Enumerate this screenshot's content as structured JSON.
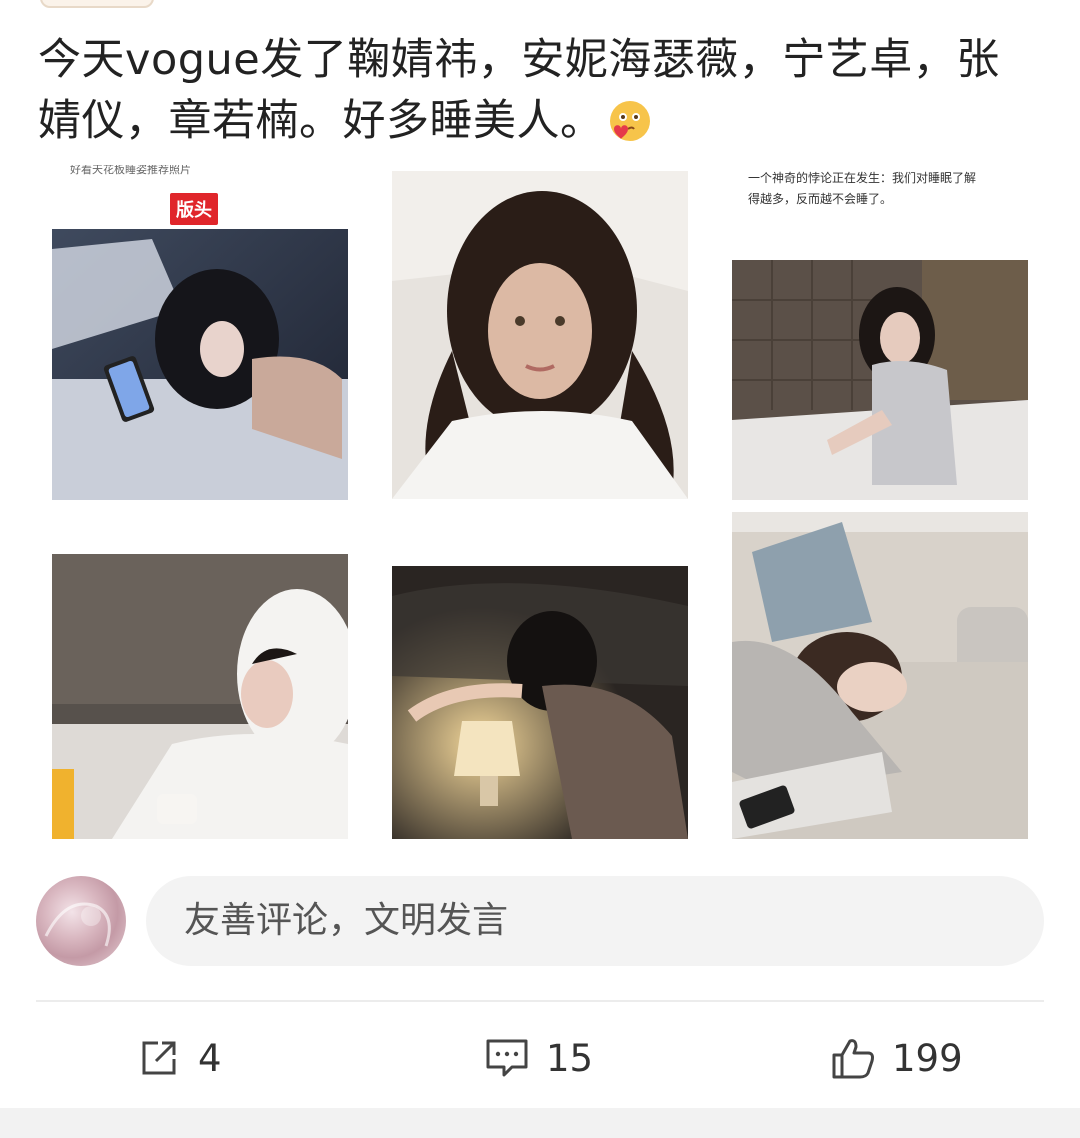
{
  "post": {
    "text": "今天vogue发了鞠婧祎，安妮海瑟薇，宁艺卓，张婧仪，章若楠。好多睡美人。",
    "emoji": "face-blowing-kiss-icon"
  },
  "images": {
    "cell1": {
      "badge": "版头",
      "top_caption": "好看天花板睡姿推荐照片"
    },
    "cell3": {
      "caption_line1": "一个神奇的悖论正在发生：我们对睡眠了解",
      "caption_line2": "得越多，反而越不会睡了。"
    }
  },
  "comment": {
    "placeholder": "友善评论，文明发言"
  },
  "actions": {
    "share_count": "4",
    "comment_count": "15",
    "like_count": "199"
  },
  "colors": {
    "badge_red": "#e0262b",
    "text": "#222222",
    "muted": "#555555"
  }
}
